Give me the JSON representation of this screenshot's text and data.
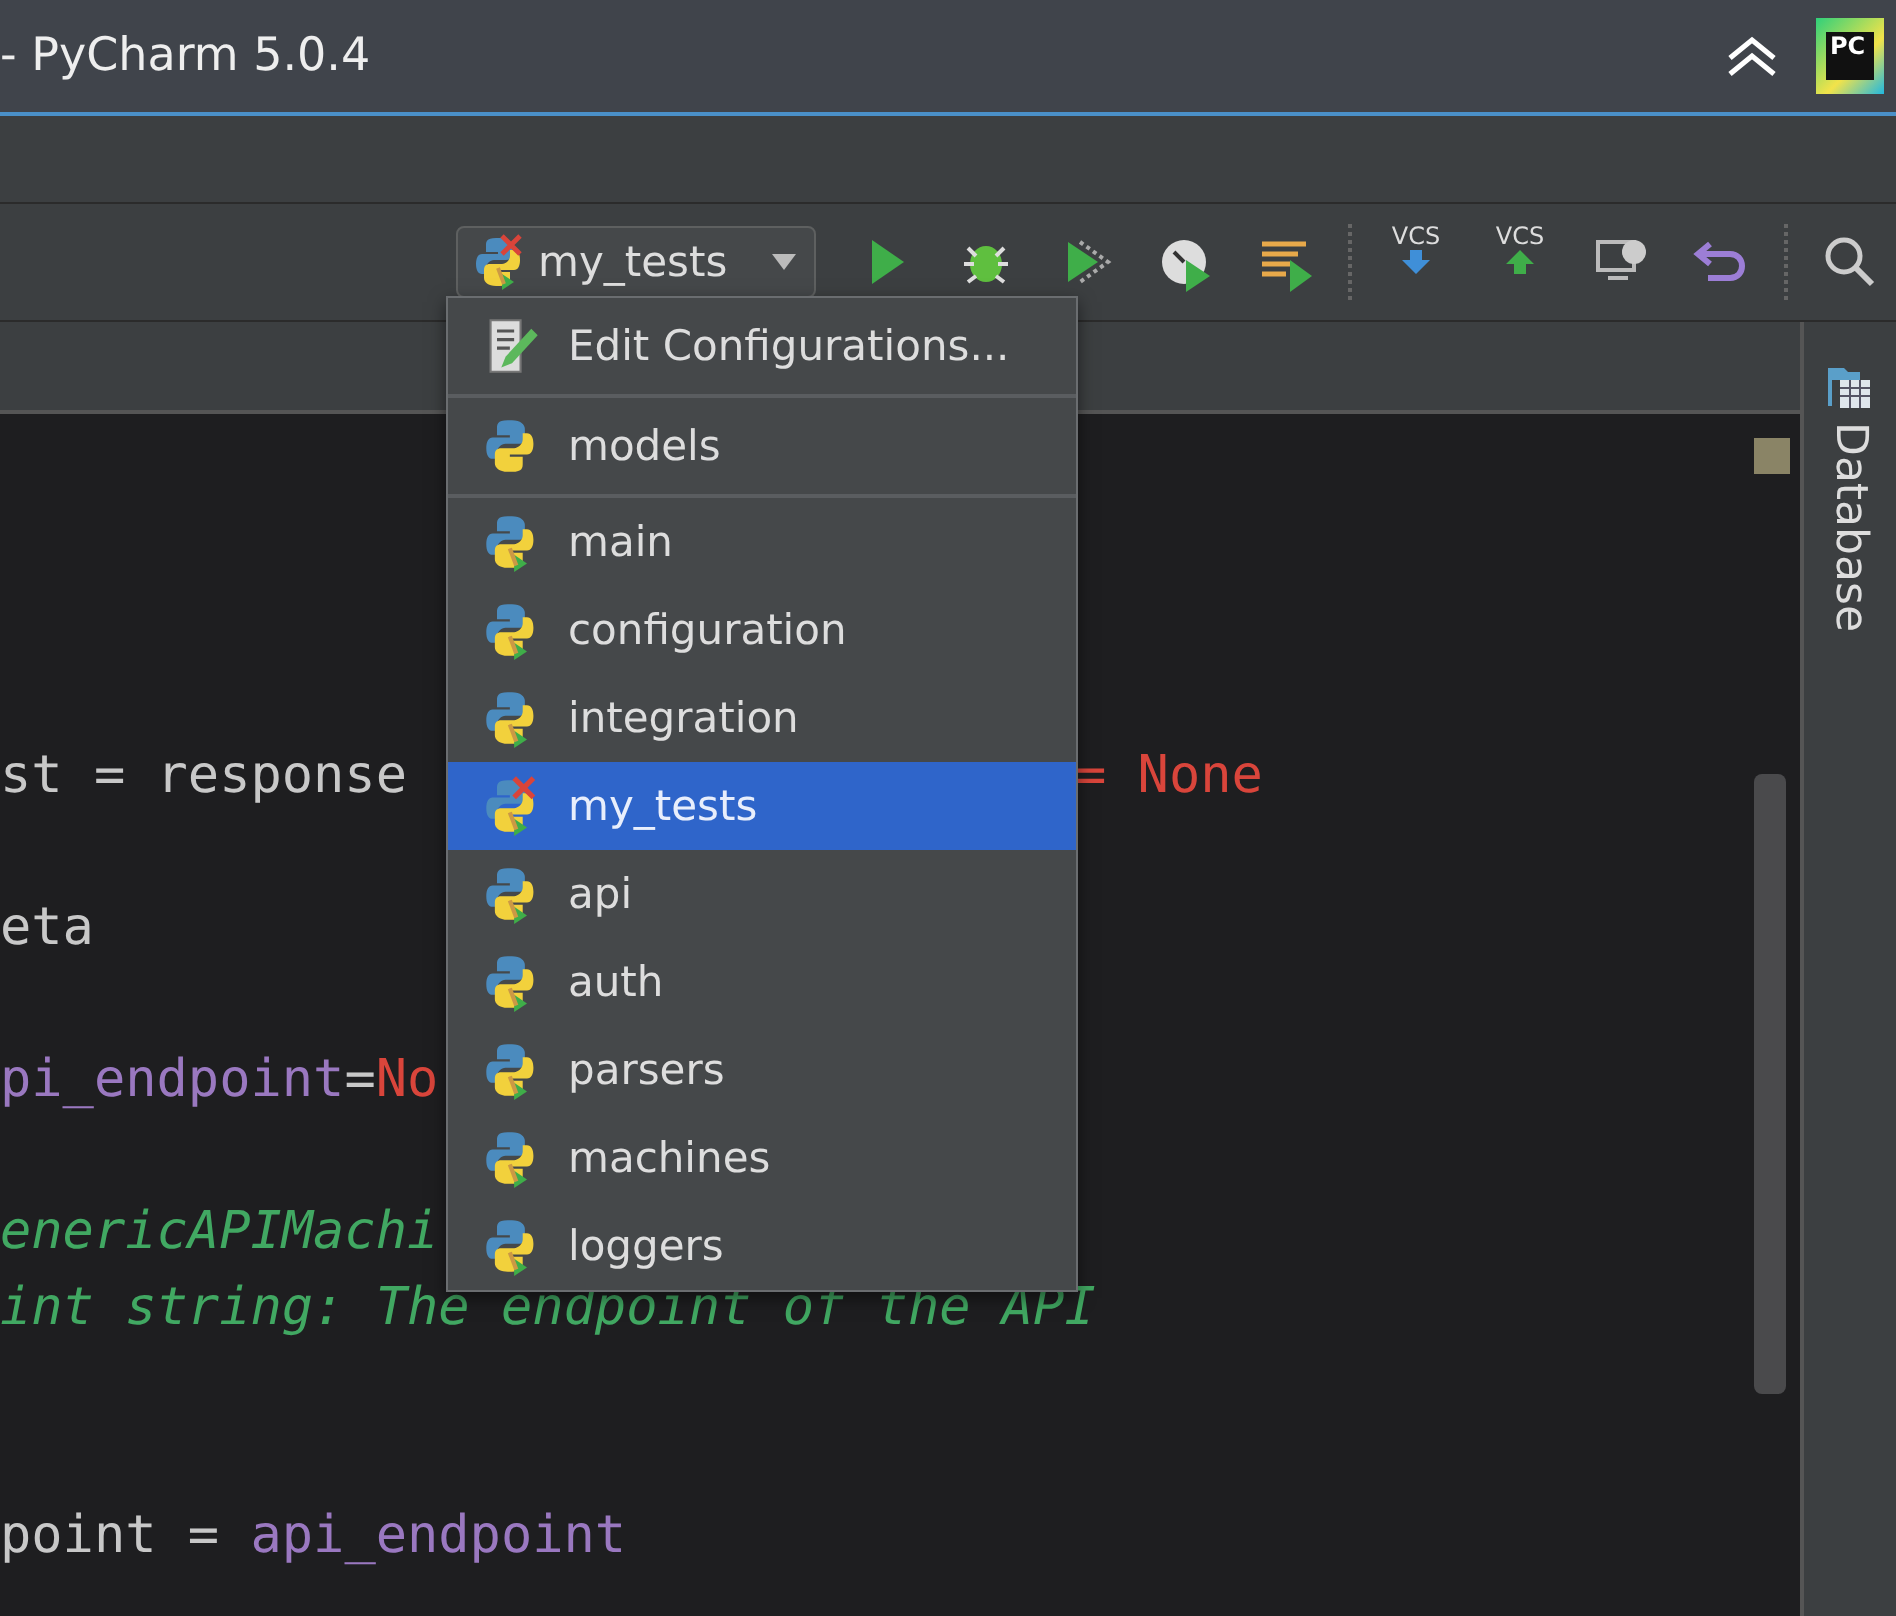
{
  "window": {
    "title": "- PyCharm 5.0.4",
    "logo_text": "PC"
  },
  "toolbar": {
    "run_config": {
      "label": "my_tests"
    },
    "vcs_buttons": [
      {
        "label": "VCS",
        "kind": "update"
      },
      {
        "label": "VCS",
        "kind": "commit"
      }
    ]
  },
  "tool_strip": {
    "label": "Database"
  },
  "editor": {
    "lines": [
      {
        "segments": [
          {
            "text": "st = response",
            "kind": "plain"
          },
          {
            "text": "= None",
            "kind": "none",
            "after_gap": true
          }
        ]
      },
      {
        "segments": [
          {
            "text": "eta",
            "kind": "plain"
          }
        ]
      },
      {
        "segments": [
          {
            "text": "pi_endpoint",
            "kind": "param"
          },
          {
            "text": "=",
            "kind": "plain"
          },
          {
            "text": "No",
            "kind": "none"
          }
        ]
      },
      {
        "segments": [
          {
            "text": "enericAPIMachi",
            "kind": "comment"
          }
        ]
      },
      {
        "segments": [
          {
            "text": "int string: The endpoint of the API",
            "kind": "comment"
          }
        ]
      },
      {
        "segments": [
          {
            "text": "point = ",
            "kind": "plain"
          },
          {
            "text": "api_endpoint",
            "kind": "param"
          }
        ]
      }
    ]
  },
  "popup": {
    "items": [
      {
        "label": "Edit Configurations...",
        "kind": "edit",
        "selected": false
      },
      {
        "label": "models",
        "kind": "plain",
        "selected": false
      },
      {
        "label": "main",
        "kind": "test",
        "selected": false
      },
      {
        "label": "configuration",
        "kind": "test",
        "selected": false
      },
      {
        "label": "integration",
        "kind": "test",
        "selected": false
      },
      {
        "label": "my_tests",
        "kind": "failed",
        "selected": true
      },
      {
        "label": "api",
        "kind": "test",
        "selected": false
      },
      {
        "label": "auth",
        "kind": "test",
        "selected": false
      },
      {
        "label": "parsers",
        "kind": "test",
        "selected": false
      },
      {
        "label": "machines",
        "kind": "test",
        "selected": false
      },
      {
        "label": "loggers",
        "kind": "test",
        "selected": false
      }
    ]
  }
}
